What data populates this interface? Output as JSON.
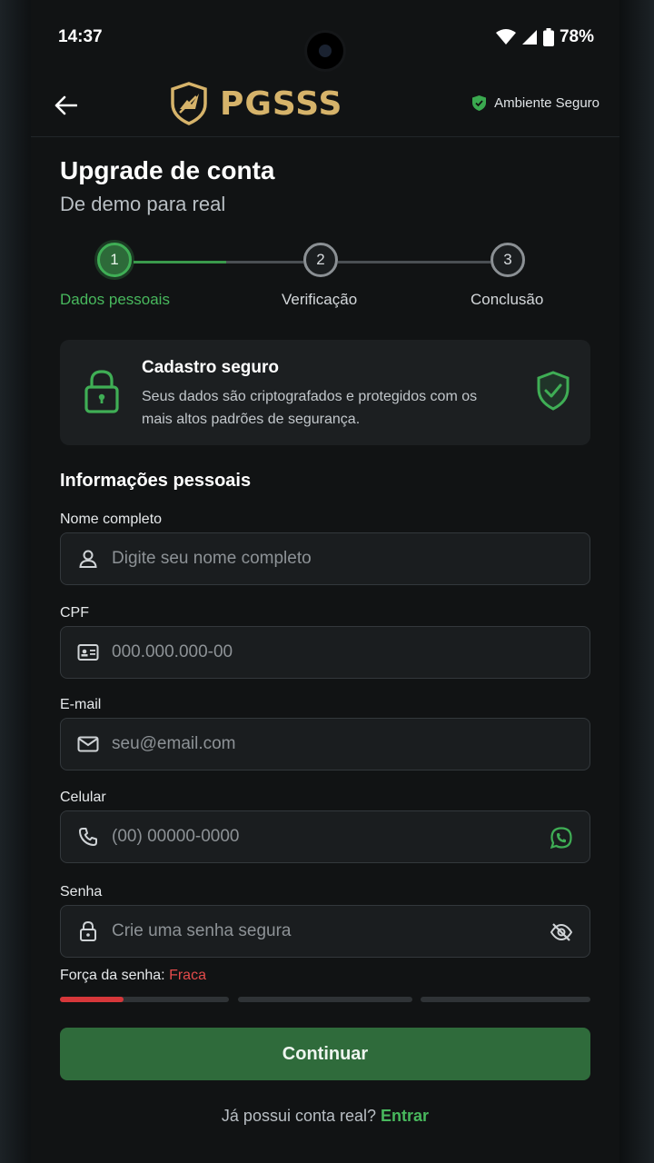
{
  "status": {
    "time": "14:37",
    "battery": "78%"
  },
  "header": {
    "brand": "PGSSS",
    "secure_label": "Ambiente Seguro"
  },
  "page": {
    "title": "Upgrade de conta",
    "subtitle": "De demo para real"
  },
  "stepper": {
    "steps": [
      {
        "number": "1",
        "label": "Dados pessoais",
        "active": true
      },
      {
        "number": "2",
        "label": "Verificação",
        "active": false
      },
      {
        "number": "3",
        "label": "Conclusão",
        "active": false
      }
    ]
  },
  "secure_card": {
    "title": "Cadastro seguro",
    "description": "Seus dados são criptografados e protegidos com os mais altos padrões de segurança."
  },
  "form": {
    "section_title": "Informações pessoais",
    "fields": {
      "name": {
        "label": "Nome completo",
        "placeholder": "Digite seu nome completo",
        "value": ""
      },
      "cpf": {
        "label": "CPF",
        "placeholder": "000.000.000-00",
        "value": ""
      },
      "email": {
        "label": "E-mail",
        "placeholder": "seu@email.com",
        "value": ""
      },
      "phone": {
        "label": "Celular",
        "placeholder": "(00) 00000-0000",
        "value": ""
      },
      "password": {
        "label": "Senha",
        "placeholder": "Crie uma senha segura",
        "value": ""
      }
    },
    "strength": {
      "label": "Força da senha:",
      "value": "Fraca",
      "level": 0.12
    },
    "continue_label": "Continuar"
  },
  "footer": {
    "question": "Já possui conta real?",
    "link": "Entrar"
  },
  "colors": {
    "accent_green": "#48b85d",
    "brand_gold": "#d6b36a",
    "weak_red": "#e34b4b",
    "button_green": "#2f6b3b"
  },
  "icons": [
    "back-arrow-icon",
    "shield-logo-icon",
    "shield-check-icon",
    "lock-icon",
    "user-icon",
    "id-card-icon",
    "mail-icon",
    "phone-icon",
    "whatsapp-icon",
    "eye-off-icon",
    "wifi-icon",
    "signal-icon",
    "battery-icon"
  ]
}
